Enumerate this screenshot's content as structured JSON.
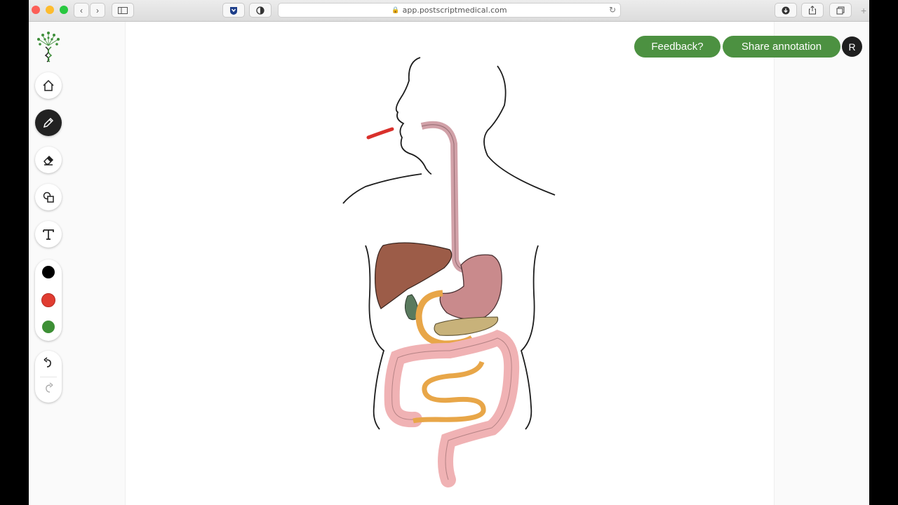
{
  "browser": {
    "url": "app.postscriptmedical.com"
  },
  "toolbar": {
    "tools": [
      {
        "name": "home",
        "icon": "home-icon"
      },
      {
        "name": "pencil",
        "icon": "pencil-icon",
        "active": true
      },
      {
        "name": "eraser",
        "icon": "eraser-icon"
      },
      {
        "name": "shapes",
        "icon": "shapes-icon"
      },
      {
        "name": "text",
        "icon": "text-icon",
        "glyph": "T"
      }
    ],
    "colors": [
      "#000000",
      "#e03c31",
      "#3d8f35"
    ],
    "undo_icon": "undo-icon",
    "redo_icon": "redo-icon"
  },
  "header": {
    "feedback_label": "Feedback?",
    "share_label": "Share annotation",
    "avatar_initial": "R"
  },
  "canvas": {
    "image": "digestive-system-diagram",
    "annotation_color": "#d9302b"
  }
}
